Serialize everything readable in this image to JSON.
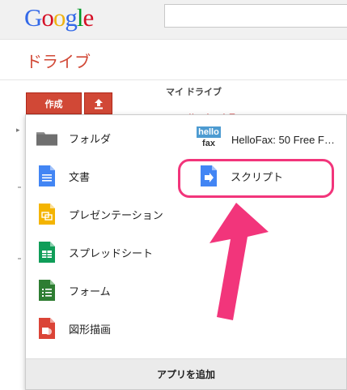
{
  "header": {
    "logo_letters": [
      {
        "ch": "G",
        "color": "#3369e8"
      },
      {
        "ch": "o",
        "color": "#d50f25"
      },
      {
        "ch": "o",
        "color": "#eeb211"
      },
      {
        "ch": "g",
        "color": "#3369e8"
      },
      {
        "ch": "l",
        "color": "#009925"
      },
      {
        "ch": "e",
        "color": "#d50f25"
      }
    ],
    "search_value": ""
  },
  "drive_title": "ドライブ",
  "toolbar": {
    "create_label": "作成",
    "upload_icon": "upload-icon"
  },
  "breadcrumb": "マイ ドライブ",
  "partial_text": "使用中の容量",
  "menu": {
    "left_items": [
      {
        "name": "folder",
        "label": "フォルダ",
        "icon": "folder-icon"
      },
      {
        "name": "document",
        "label": "文書",
        "icon": "docs-icon"
      },
      {
        "name": "presentation",
        "label": "プレゼンテーション",
        "icon": "slides-icon"
      },
      {
        "name": "spreadsheet",
        "label": "スプレッドシート",
        "icon": "sheets-icon"
      },
      {
        "name": "form",
        "label": "フォーム",
        "icon": "forms-icon"
      },
      {
        "name": "drawing",
        "label": "図形描画",
        "icon": "drawing-icon"
      }
    ],
    "right_items": [
      {
        "name": "hellofax",
        "label": "HelloFax: 50 Free F…",
        "icon": "hellofax-icon",
        "logo_top": "hello",
        "logo_bottom": "fax"
      },
      {
        "name": "script",
        "label": "スクリプト",
        "icon": "script-icon"
      }
    ],
    "add_apps_label": "アプリを追加"
  },
  "annotation_color": "#f2357b"
}
